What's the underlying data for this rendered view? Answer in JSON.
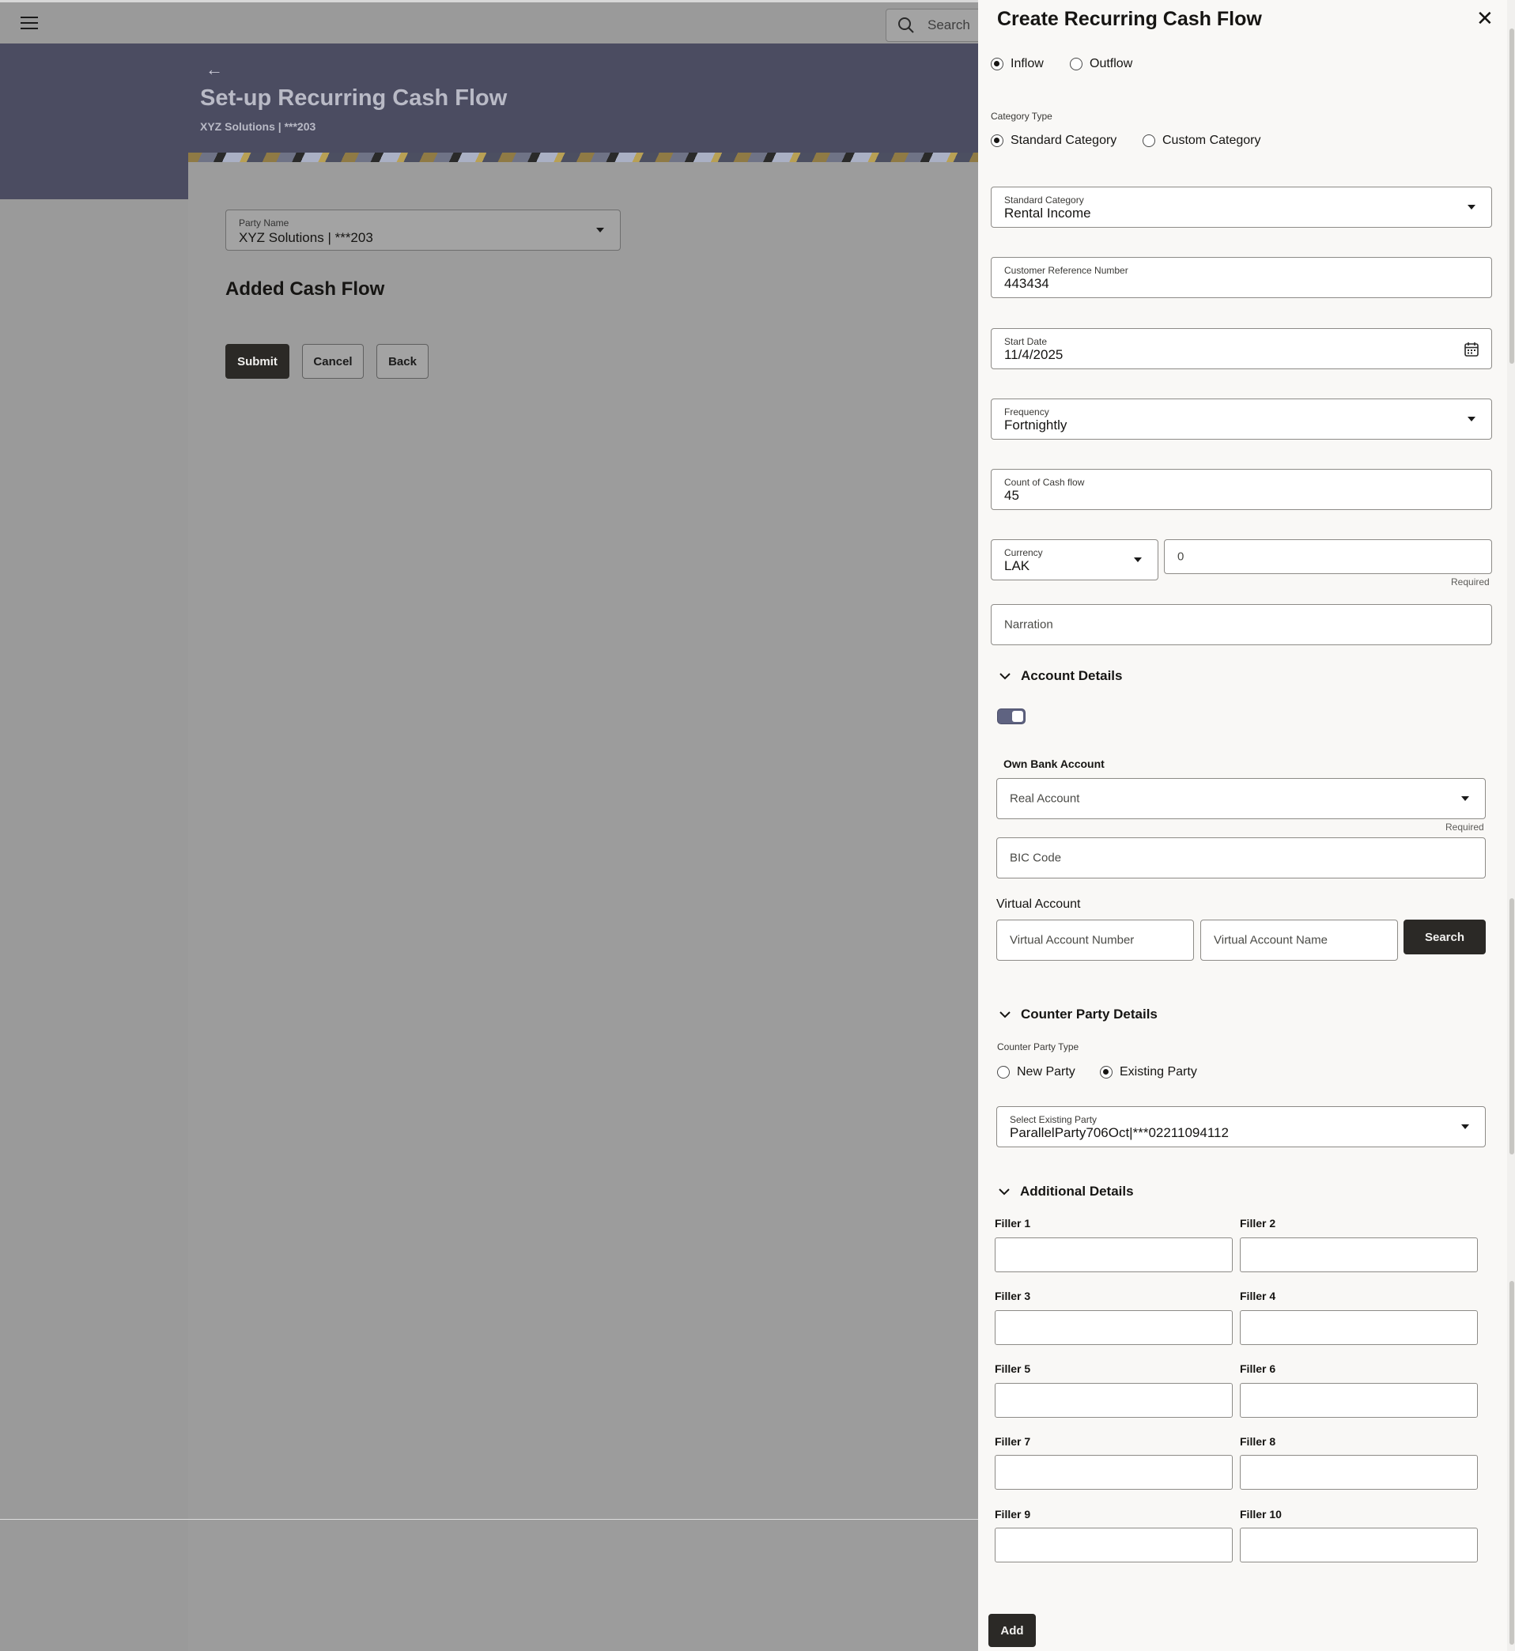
{
  "topbar": {
    "search_placeholder": "Search"
  },
  "hero": {
    "back_glyph": "←",
    "title": "Set-up Recurring Cash Flow",
    "subtitle": "XYZ Solutions | ***203"
  },
  "main": {
    "party_name_label": "Party Name",
    "party_name_value": "XYZ Solutions | ***203",
    "section_title": "Added Cash Flow",
    "submit_label": "Submit",
    "cancel_label": "Cancel",
    "back_label": "Back"
  },
  "panel": {
    "title": "Create Recurring Cash Flow",
    "close_glyph": "✕",
    "flow_options": [
      {
        "label": "Inflow",
        "selected": true
      },
      {
        "label": "Outflow",
        "selected": false
      }
    ],
    "category_type_label": "Category Type",
    "category_options": [
      {
        "label": "Standard Category",
        "selected": true
      },
      {
        "label": "Custom Category",
        "selected": false
      }
    ],
    "standard_category": {
      "label": "Standard Category",
      "value": "Rental Income"
    },
    "customer_reference": {
      "label": "Customer Reference Number",
      "value": "443434"
    },
    "start_date": {
      "label": "Start Date",
      "value": "11/4/2025"
    },
    "frequency": {
      "label": "Frequency",
      "value": "Fortnightly"
    },
    "count": {
      "label": "Count of Cash flow",
      "value": "45"
    },
    "currency": {
      "label": "Currency",
      "value": "LAK"
    },
    "amount_placeholder": "0",
    "amount_required": "Required",
    "narration_placeholder": "Narration",
    "account_details": {
      "title": "Account Details",
      "own_bank_label": "Own Bank Account",
      "real_account_placeholder": "Real Account",
      "real_account_required": "Required",
      "bic_placeholder": "BIC Code",
      "virtual_account_label": "Virtual Account",
      "virtual_number_placeholder": "Virtual Account Number",
      "virtual_name_placeholder": "Virtual Account Name",
      "search_label": "Search"
    },
    "counter_party": {
      "title": "Counter Party Details",
      "type_label": "Counter Party Type",
      "options": [
        {
          "label": "New Party",
          "selected": false
        },
        {
          "label": "Existing Party",
          "selected": true
        }
      ],
      "select_label": "Select Existing Party",
      "select_value": "ParallelParty706Oct|***02211094112"
    },
    "additional": {
      "title": "Additional Details",
      "fillers": [
        "Filler 1",
        "Filler 2",
        "Filler 3",
        "Filler 4",
        "Filler 5",
        "Filler 6",
        "Filler 7",
        "Filler 8",
        "Filler 9",
        "Filler 10"
      ]
    },
    "add_label": "Add"
  },
  "colors": {
    "hero_bg": "#4b4c61",
    "overlay_gray": "#9a9a9a",
    "dark_button": "#2b2926",
    "toggle_on": "#5f6381",
    "panel_bg": "#f9f8f6"
  }
}
